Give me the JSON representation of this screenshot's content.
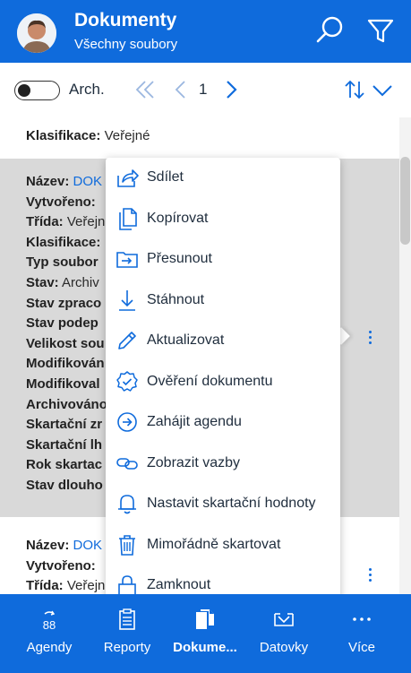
{
  "header": {
    "title": "Dokumenty",
    "subtitle": "Všechny soubory",
    "color": "#0f6bdc"
  },
  "toolbar": {
    "archive_label": "Arch.",
    "page": "1"
  },
  "cards": {
    "top": {
      "row": {
        "label": "Klasifikace:",
        "value": "Veřejné"
      }
    },
    "selected": {
      "rows": [
        {
          "label": "Název:",
          "value": "DOK"
        },
        {
          "label": "Vytvořeno:",
          "value": ""
        },
        {
          "label": "Třída:",
          "value": "Veřejn"
        },
        {
          "label": "Klasifikace:",
          "value": ""
        },
        {
          "label": "Typ soubor",
          "value": ""
        },
        {
          "label": "Stav:",
          "value": "Archiv"
        },
        {
          "label": "Stav zpraco",
          "value": ""
        },
        {
          "label": "Stav podep",
          "value": ""
        },
        {
          "label": "Velikost sou",
          "value": ""
        },
        {
          "label": "Modifikován",
          "value": ""
        },
        {
          "label": "Modifikoval",
          "value": ""
        },
        {
          "label": "Archivováno",
          "value": ""
        },
        {
          "label": "Skartační zr",
          "value": ""
        },
        {
          "label": "Skartační lh",
          "value": ""
        },
        {
          "label": "Rok skartac",
          "value": ""
        },
        {
          "label": "Stav dlouho",
          "value": ""
        }
      ]
    },
    "bottom": {
      "rows": [
        {
          "label": "Název:",
          "value": "DOK"
        },
        {
          "label": "Vytvořeno:",
          "value": ""
        },
        {
          "label": "Třída:",
          "value": "Veřejn"
        }
      ]
    }
  },
  "menu": {
    "items": [
      {
        "label": "Sdílet",
        "icon": "share-icon"
      },
      {
        "label": "Kopírovat",
        "icon": "copy-icon"
      },
      {
        "label": "Přesunout",
        "icon": "move-icon"
      },
      {
        "label": "Stáhnout",
        "icon": "download-icon"
      },
      {
        "label": "Aktualizovat",
        "icon": "pencil-icon"
      },
      {
        "label": "Ověření dokumentu",
        "icon": "verified-badge-icon"
      },
      {
        "label": "Zahájit agendu",
        "icon": "arrow-circle-icon"
      },
      {
        "label": "Zobrazit vazby",
        "icon": "link-icon"
      },
      {
        "label": "Nastavit skartační hodnoty",
        "icon": "bell-icon"
      },
      {
        "label": "Mimořádně skartovat",
        "icon": "trash-icon"
      },
      {
        "label": "Zamknout",
        "icon": "lock-icon"
      }
    ]
  },
  "bottom_nav": {
    "items": [
      {
        "label": "Agendy",
        "icon": "agendas-icon"
      },
      {
        "label": "Reporty",
        "icon": "report-icon"
      },
      {
        "label": "Dokume...",
        "icon": "documents-icon"
      },
      {
        "label": "Datovky",
        "icon": "databox-icon"
      },
      {
        "label": "Více",
        "icon": "more-icon"
      }
    ]
  }
}
